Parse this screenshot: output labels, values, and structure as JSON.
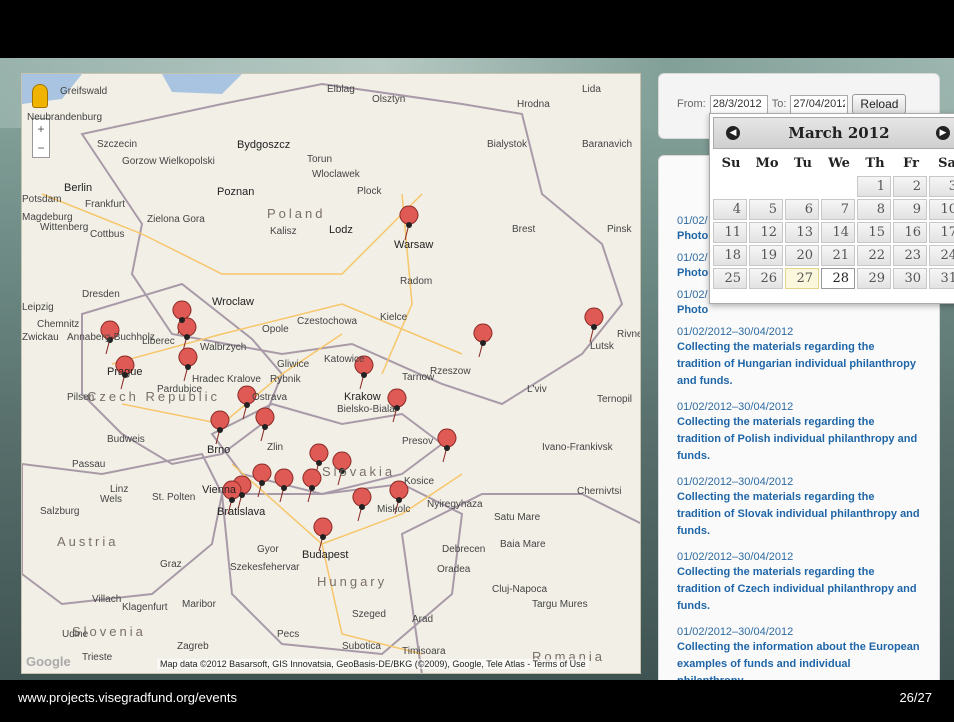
{
  "dates": {
    "from_label": "From:",
    "from_value": "28/3/2012",
    "to_label": "To:",
    "to_value": "27/04/2012",
    "reload_label": "Reload"
  },
  "datepicker": {
    "title": "March 2012",
    "weekdays": [
      "Su",
      "Mo",
      "Tu",
      "We",
      "Th",
      "Fr",
      "Sa"
    ],
    "days": [
      "",
      "",
      "",
      "",
      "1",
      "2",
      "3",
      "4",
      "5",
      "6",
      "7",
      "8",
      "9",
      "10",
      "11",
      "12",
      "13",
      "14",
      "15",
      "16",
      "17",
      "18",
      "19",
      "20",
      "21",
      "22",
      "23",
      "24",
      "25",
      "26",
      "27",
      "28",
      "29",
      "30",
      "31"
    ],
    "today": "27",
    "selected": "28"
  },
  "events": [
    {
      "date": "01/02/",
      "title": "Photo"
    },
    {
      "date": "01/02/",
      "title": "Photo"
    },
    {
      "date": "01/02/",
      "title": "Photo"
    },
    {
      "date": "01/02/2012–30/04/2012",
      "title": "Collecting the materials regarding the tradition of Hungarian individual philanthropy and funds."
    },
    {
      "date": "01/02/2012–30/04/2012",
      "title": "Collecting the materials regarding the tradition of Polish individual philanthropy and funds."
    },
    {
      "date": "01/02/2012–30/04/2012",
      "title": "Collecting the materials regarding the tradition of Slovak individual philanthropy and funds."
    },
    {
      "date": "01/02/2012–30/04/2012",
      "title": "Collecting the materials regarding the tradition of Czech individual philanthropy and funds."
    },
    {
      "date": "01/02/2012–30/04/2012",
      "title": "Collecting the information about the European examples of funds and individual philanthropy."
    }
  ],
  "map": {
    "countries": [
      "Poland",
      "Czech Republic",
      "Slovakia",
      "Austria",
      "Hungary",
      "Slovenia",
      "Romania"
    ],
    "cities": [
      "Berlin",
      "Szczecin",
      "Bydgoszcz",
      "Elblag",
      "Olsztyn",
      "Hrodna",
      "Lida",
      "Bialystok",
      "Baranavich",
      "Torun",
      "Poznan",
      "Plock",
      "Warsaw",
      "Lodz",
      "Wroclaw",
      "Kalisz",
      "Radom",
      "Brest",
      "Pinsk",
      "Kielce",
      "Czestochowa",
      "Opole",
      "Katowice",
      "Krakow",
      "Rzeszow",
      "Tarnow",
      "L'viv",
      "Lutsk",
      "Rivne",
      "Dresden",
      "Leipzig",
      "Chemnitz",
      "Prague",
      "Liberec",
      "Pardubice",
      "Hradec Kralove",
      "Ostrava",
      "Brno",
      "Zlin",
      "Presov",
      "Kosice",
      "Miskolc",
      "Nyiregyhaza",
      "Budapest",
      "Debrecen",
      "Vienna",
      "Bratislava",
      "Linz",
      "Graz",
      "Salzburg",
      "Gyor",
      "Szekesfehervar",
      "Szeged",
      "Arad",
      "Oradea",
      "Cluj-Napoca",
      "Targu Mures",
      "Zagreb",
      "Pecs",
      "Subotica",
      "Timisoara",
      "Ternopil",
      "Ivano-Frankivsk",
      "Chernivtsi",
      "Satu Mare",
      "Baia Mare",
      "Maribor",
      "Villach",
      "Klagenfurt",
      "Udine",
      "Trieste",
      "Potsdam",
      "Magdeburg",
      "Cottbus",
      "Zielona Gora",
      "Gorzow Wielkopolski",
      "Wloclawek",
      "Walbrzych",
      "Rybnik",
      "Gliwice",
      "Bielsko-Biala",
      "Pilsen",
      "Budweis",
      "Passau",
      "St. Polten",
      "Wels",
      "Neubrandenburg",
      "Greifswald",
      "Frankfurt",
      "Wittenberg",
      "Zwickau",
      "Annaberg-Buchholz"
    ],
    "attribution": "Map data ©2012 Basarsoft, GIS Innovatsia, GeoBasis-DE/BKG (©2009), Google, Tele Atlas - Terms of Use",
    "logo": "Google"
  },
  "footer": {
    "url": "www.projects.visegradfund.org/events",
    "page": "26/27"
  }
}
